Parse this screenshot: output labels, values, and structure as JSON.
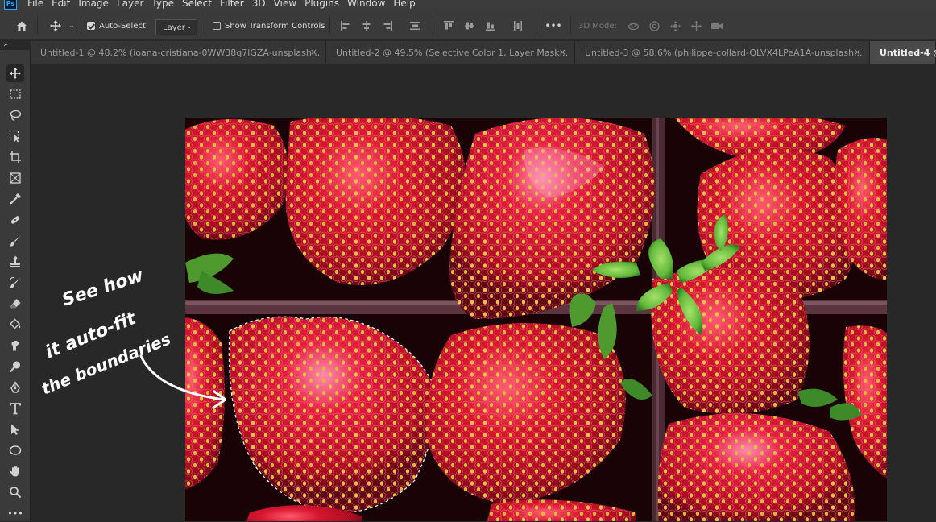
{
  "app": {
    "logo": "Ps",
    "menu": [
      "File",
      "Edit",
      "Image",
      "Layer",
      "Type",
      "Select",
      "Filter",
      "3D",
      "View",
      "Plugins",
      "Window",
      "Help"
    ]
  },
  "options": {
    "auto_select_label": "Auto-Select:",
    "auto_select_checked": true,
    "layer_dropdown": "Layer",
    "show_transform_label": "Show Transform Controls",
    "show_transform_checked": false,
    "more": "•••",
    "mode_3d_label": "3D Mode:"
  },
  "tabs": [
    {
      "title": "Untitled-1 @ 48.2% (ioana-cristiana-0WW38q7lGZA-unsplash...",
      "close": "×",
      "active": false
    },
    {
      "title": "Untitled-2 @ 49.5% (Selective Color 1, Layer Mask...",
      "close": "×",
      "active": false
    },
    {
      "title": "Untitled-3 @ 58.6% (philippe-collard-QLVX4LPeA1A-unsplash...",
      "close": "×",
      "active": false
    },
    {
      "title": "Untitled-4 @ 5",
      "close": "",
      "active": true
    }
  ],
  "toolbar": {
    "handle": "»",
    "more": "•••"
  },
  "annotation": {
    "lines": [
      "See how",
      "it auto-fit",
      "the boundaries"
    ]
  },
  "colors": {
    "panel": "#3a3a3a",
    "workspace": "#282828",
    "strawberry": "#c0152a",
    "seed": "#e8c04a",
    "leaf": "#5fb83a"
  }
}
